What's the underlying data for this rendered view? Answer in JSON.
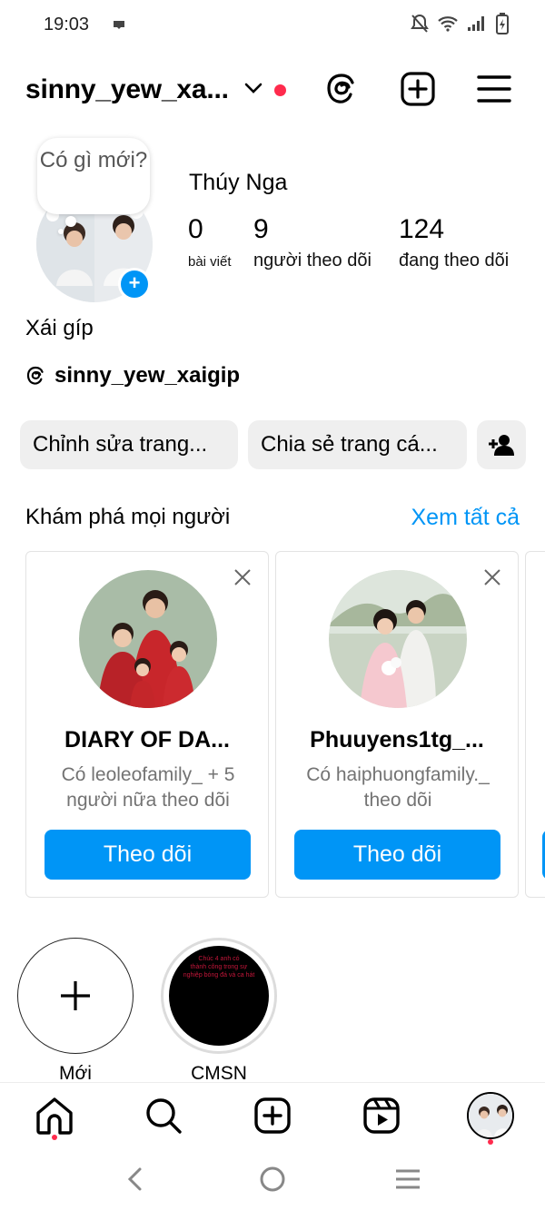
{
  "status_bar": {
    "time": "19:03"
  },
  "header": {
    "username": "sinny_yew_xa..."
  },
  "profile": {
    "note_text": "Có gì mới?",
    "display_name": "Thúy Nga",
    "stats": {
      "posts_count": "0",
      "posts_label": "bài viết",
      "followers_count": "9",
      "followers_label": "người theo dõi",
      "following_count": "124",
      "following_label": "đang theo dõi"
    },
    "bio_name": "Xái gíp",
    "threads_handle": "sinny_yew_xaigip"
  },
  "actions": {
    "edit_label": "Chỉnh sửa trang...",
    "share_label": "Chia sẻ trang cá..."
  },
  "discover": {
    "title": "Khám phá mọi người",
    "see_all": "Xem tất cả",
    "cards": [
      {
        "name": "DIARY OF DA...",
        "subtitle": "Có leoleofamily_ + 5 người nữa theo dõi",
        "button": "Theo dõi"
      },
      {
        "name": "Phuuyens1tg_...",
        "subtitle": "Có haiphuongfamily._ theo dõi",
        "button": "Theo dõi"
      }
    ]
  },
  "highlights": [
    {
      "label": "Mới"
    },
    {
      "label": "CMSN",
      "cover_text": "Chúc 4 anh có thành công trong sự nghiệp bóng đá và ca hát"
    }
  ],
  "bottom_nav": {
    "items": [
      "home-icon",
      "search-icon",
      "create-icon",
      "reels-icon",
      "profile-avatar"
    ]
  },
  "colors": {
    "accent": "#0095f6",
    "notification": "#ff2b4d",
    "button_bg": "#efefef"
  }
}
